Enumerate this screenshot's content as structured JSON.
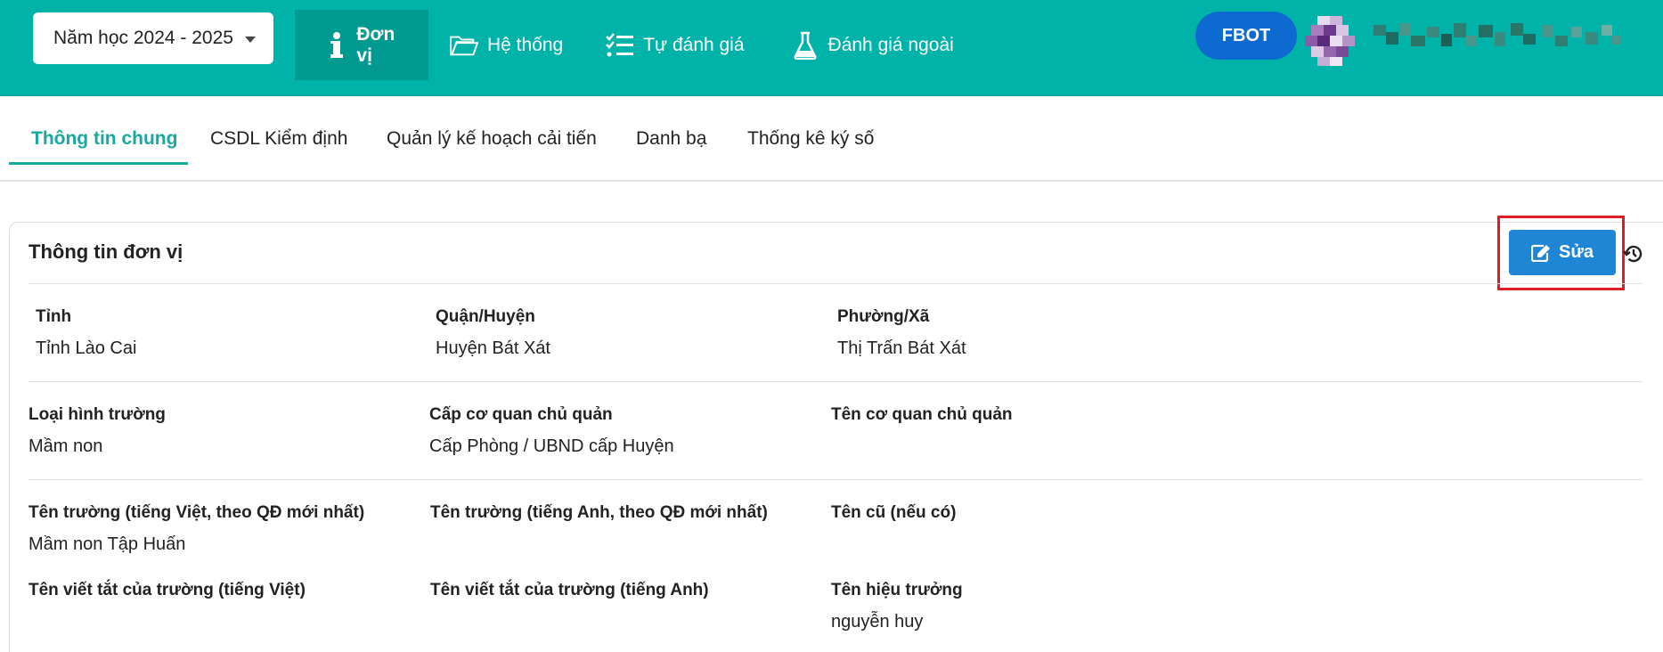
{
  "topbar": {
    "year_select": "Năm học 2024 - 2025",
    "nav": [
      {
        "label": "Đơn vị"
      },
      {
        "label": "Hệ thống"
      },
      {
        "label": "Tự đánh giá"
      },
      {
        "label": "Đánh giá ngoài"
      }
    ],
    "fbot_label": "FBOT"
  },
  "tabs": [
    {
      "label": "Thông tin chung"
    },
    {
      "label": "CSDL Kiểm định"
    },
    {
      "label": "Quản lý kế hoạch cải tiến"
    },
    {
      "label": "Danh bạ"
    },
    {
      "label": "Thống kê ký số"
    }
  ],
  "card": {
    "title": "Thông tin đơn vị",
    "edit_label": "Sửa",
    "rows": [
      [
        {
          "label": "Tỉnh",
          "value": "Tỉnh Lào Cai"
        },
        {
          "label": "Quận/Huyện",
          "value": "Huyện Bát Xát"
        },
        {
          "label": "Phường/Xã",
          "value": "Thị Trấn Bát Xát"
        }
      ],
      [
        {
          "label": "Loại hình trường",
          "value": "Mầm non"
        },
        {
          "label": "Cấp cơ quan chủ quản",
          "value": "Cấp Phòng / UBND cấp Huyện"
        },
        {
          "label": "Tên cơ quan chủ quản",
          "value": ""
        }
      ],
      [
        {
          "label": "Tên trường (tiếng Việt, theo QĐ mới nhất)",
          "value": "Mầm non Tập Huấn"
        },
        {
          "label": "Tên trường (tiếng Anh, theo QĐ mới nhất)",
          "value": ""
        },
        {
          "label": "Tên cũ (nếu có)",
          "value": ""
        }
      ],
      [
        {
          "label": "Tên viết tắt của trường (tiếng Việt)",
          "value": ""
        },
        {
          "label": "Tên viết tắt của trường (tiếng Anh)",
          "value": ""
        },
        {
          "label": "Tên hiệu trưởng",
          "value": "nguyễn huy"
        }
      ]
    ]
  },
  "colors": {
    "topbar": "#00b3a8",
    "topbar_active": "#009a90",
    "fbot": "#0d6ad1",
    "tab_active": "#17a99b",
    "edit_button": "#1f86d6",
    "highlight": "#e01b24"
  }
}
